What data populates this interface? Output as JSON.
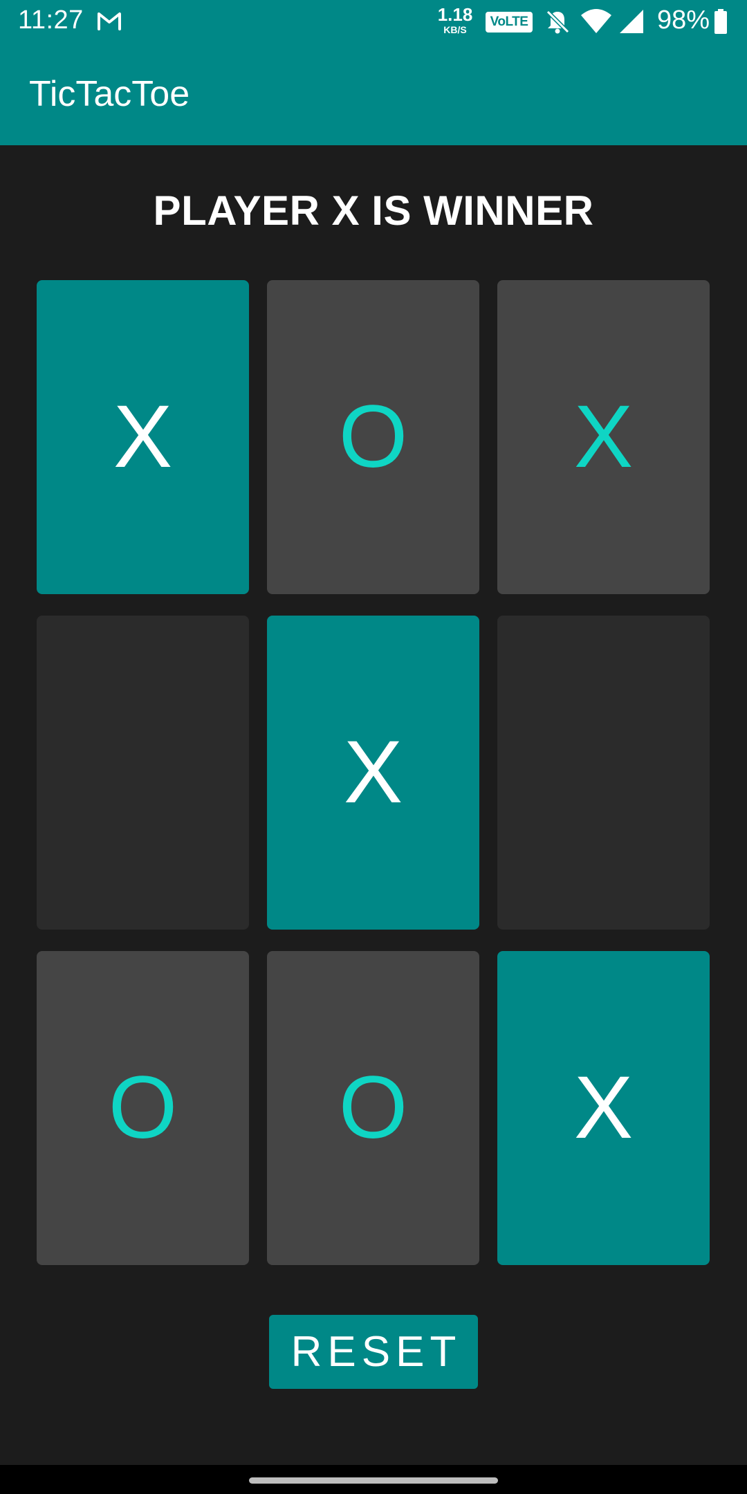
{
  "colors": {
    "teal": "#008887",
    "cell_played": "#454545",
    "cell_empty": "#2b2b2b",
    "mark_accent": "#0fd5c4",
    "mark_white": "#ffffff",
    "background": "#1c1c1c"
  },
  "status_bar": {
    "time": "11:27",
    "speed_value": "1.18",
    "speed_unit": "KB/S",
    "volte": "VoLTE",
    "battery": "98%",
    "icons": [
      "gmail-icon",
      "bell-off-icon",
      "wifi-icon",
      "signal-icon",
      "battery-icon"
    ]
  },
  "app_bar": {
    "title": "TicTacToe"
  },
  "game": {
    "status": "PLAYER X IS WINNER",
    "board": [
      {
        "mark": "X",
        "state": "winning"
      },
      {
        "mark": "O",
        "state": "played"
      },
      {
        "mark": "X",
        "state": "played"
      },
      {
        "mark": "",
        "state": "empty"
      },
      {
        "mark": "X",
        "state": "winning"
      },
      {
        "mark": "",
        "state": "empty"
      },
      {
        "mark": "O",
        "state": "played"
      },
      {
        "mark": "O",
        "state": "played"
      },
      {
        "mark": "X",
        "state": "winning"
      }
    ]
  },
  "reset_label": "RESET"
}
